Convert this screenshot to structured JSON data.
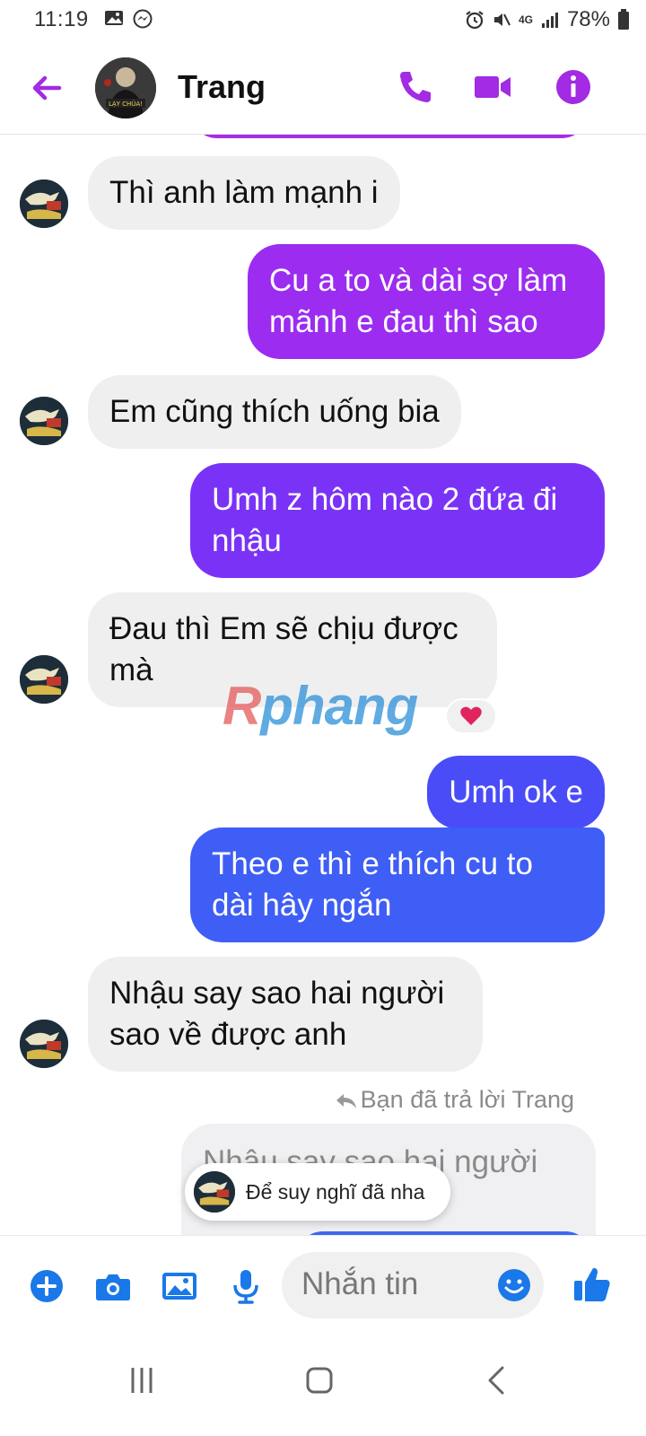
{
  "status_bar": {
    "time": "11:19",
    "battery_text": "78%",
    "network_label": "4G"
  },
  "header": {
    "contact_name": "Trang",
    "icons": [
      "back-arrow-icon",
      "phone-icon",
      "video-camera-icon",
      "info-icon"
    ],
    "accent_color": "#a22be3"
  },
  "messages": [
    {
      "side": "in",
      "text": "Thì anh làm mạnh i"
    },
    {
      "side": "out",
      "text": "Cu a to và dài sợ làm mãnh e đau thì sao",
      "color": "#9b2cf0"
    },
    {
      "side": "in",
      "text": "Em cũng thích uống bia"
    },
    {
      "side": "out",
      "text": "Umh z hôm nào 2 đứa đi nhậu",
      "color": "#7a33f6"
    },
    {
      "side": "in",
      "text": "Đau thì Em sẽ chịu được mà",
      "reaction": "heart"
    },
    {
      "side": "out",
      "text": "Umh ok e",
      "color": "#4a4cf7"
    },
    {
      "side": "out",
      "text": "Theo e thì e thích cu to dài hây ngắn",
      "color": "#3f5ef6"
    },
    {
      "side": "in",
      "text": "Nhậu say sao hai người sao về được anh"
    },
    {
      "side": "out-quote",
      "text": "Nhậu say sao hai người"
    }
  ],
  "reply_note": "Bạn đã trả lời Trang",
  "watermark": {
    "left": "R",
    "right": "phang"
  },
  "typing_toast": "Để suy nghĩ đã nha",
  "composer": {
    "placeholder": "Nhắn tin",
    "icons": [
      "plus-icon",
      "camera-icon",
      "gallery-icon",
      "microphone-icon",
      "emoji-icon",
      "thumbs-up-icon"
    ],
    "icon_color": "#1a78e8"
  }
}
